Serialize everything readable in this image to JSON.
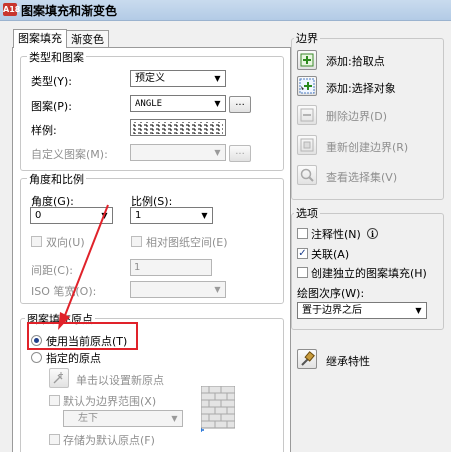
{
  "window": {
    "title": "图案填充和渐变色",
    "app_icon": "A18"
  },
  "tabs": [
    {
      "label": "图案填充",
      "active": true
    },
    {
      "label": "渐变色",
      "active": false
    }
  ],
  "type_pattern": {
    "title": "类型和图案",
    "type_label": "类型(Y):",
    "type_value": "预定义",
    "pattern_label": "图案(P):",
    "pattern_value": "ANGLE",
    "sample_label": "样例:",
    "custom_label": "自定义图案(M):",
    "custom_value": ""
  },
  "angle_scale": {
    "title": "角度和比例",
    "angle_label": "角度(G):",
    "angle_value": "0",
    "scale_label": "比例(S):",
    "scale_value": "1",
    "double_label": "双向(U)",
    "relative_label": "相对图纸空间(E)",
    "spacing_label": "间距(C):",
    "spacing_value": "1",
    "iso_label": "ISO 笔宽(O):",
    "iso_value": ""
  },
  "origin": {
    "title": "图案填充原点",
    "use_current_label": "使用当前原点(T)",
    "use_current_selected": true,
    "specified_label": "指定的原点",
    "click_set_label": "单击以设置新原点",
    "default_extent_label": "默认为边界范围(X)",
    "extent_value": "左下",
    "store_default_label": "存储为默认原点(F)"
  },
  "boundary": {
    "title": "边界",
    "add_pick_label": "添加:拾取点",
    "add_select_label": "添加:选择对象",
    "remove_label": "删除边界(D)",
    "recreate_label": "重新创建边界(R)",
    "view_selection_label": "查看选择集(V)"
  },
  "options": {
    "title": "选项",
    "annotative_label": "注释性(N)",
    "annotative_checked": false,
    "associative_label": "关联(A)",
    "associative_checked": true,
    "independent_label": "创建独立的图案填充(H)",
    "independent_checked": false,
    "draw_order_label": "绘图次序(W):",
    "draw_order_value": "置于边界之后"
  },
  "inherit": {
    "label": "继承特性"
  },
  "annotation": {
    "highlight_color": "#e0222a",
    "arrow_color": "#e0222a"
  }
}
